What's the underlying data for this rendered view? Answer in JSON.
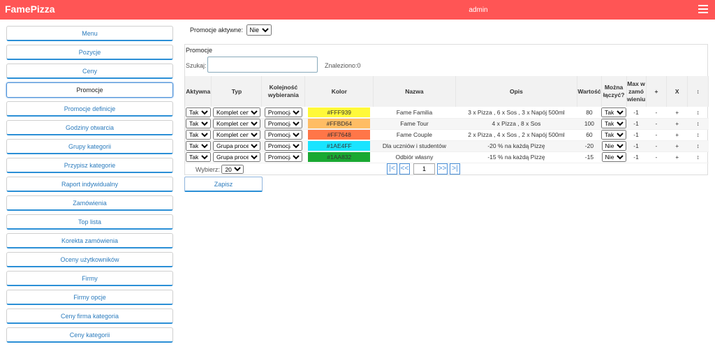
{
  "app": {
    "title": "FamePizza",
    "user": "admin"
  },
  "sidebar": {
    "items": [
      {
        "label": "Menu"
      },
      {
        "label": "Pozycje"
      },
      {
        "label": "Ceny"
      },
      {
        "label": "Promocje"
      },
      {
        "label": "Promocje definicje"
      },
      {
        "label": "Godziny otwarcia"
      },
      {
        "label": "Grupy kategorii"
      },
      {
        "label": "Przypisz kategorie"
      },
      {
        "label": "Raport indywidualny"
      },
      {
        "label": "Zamówienia"
      },
      {
        "label": "Top lista"
      },
      {
        "label": "Korekta zamówienia"
      },
      {
        "label": "Oceny użytkowników"
      },
      {
        "label": "Firmy"
      },
      {
        "label": "Firmy opcje"
      },
      {
        "label": "Ceny firma kategoria"
      },
      {
        "label": "Ceny kategorii"
      }
    ],
    "active_index": 3
  },
  "filter": {
    "label": "Promocje aktywne:",
    "value": "Nie"
  },
  "panel": {
    "title": "Promocje",
    "search_label": "Szukaj:",
    "search_value": "",
    "found": "Znaleziono:0"
  },
  "table": {
    "headers": [
      "Aktywna",
      "Typ",
      "Kolejność wybierania",
      "Kolor",
      "Nazwa",
      "Opis",
      "Wartość",
      "Można łączyć?",
      "Max w zamó wieniu",
      "+",
      "X",
      "↕"
    ],
    "rows": [
      {
        "aktywna": "Tak",
        "typ": "Komplet cena",
        "kolejnosc": "Promocja",
        "kolor": "#FFF939",
        "color_hex": "#FFF939",
        "nazwa": "Fame Familia",
        "opis": "3 x Pizza , 6 x Sos , 3 x Napój 500ml",
        "wartosc": "80",
        "laczyc": "Tak",
        "max": "-1",
        "plus": "-",
        "x": "+",
        "move": "↕"
      },
      {
        "aktywna": "Tak",
        "typ": "Komplet cena",
        "kolejnosc": "Promocja",
        "kolor": "#FFBD64",
        "color_hex": "#FFBD64",
        "nazwa": "Fame Tour",
        "opis": "4 x Pizza , 8 x Sos",
        "wartosc": "100",
        "laczyc": "Tak",
        "max": "-1",
        "plus": "-",
        "x": "+",
        "move": "↕"
      },
      {
        "aktywna": "Tak",
        "typ": "Komplet cena",
        "kolejnosc": "Promocja",
        "kolor": "#FF7648",
        "color_hex": "#FF7648",
        "nazwa": "Fame Couple",
        "opis": "2 x Pizza , 4 x Sos , 2 x Napój 500ml",
        "wartosc": "60",
        "laczyc": "Tak",
        "max": "-1",
        "plus": "-",
        "x": "+",
        "move": "↕"
      },
      {
        "aktywna": "Tak",
        "typ": "Grupa procent",
        "kolejnosc": "Promocja",
        "kolor": "#1AE4FF",
        "color_hex": "#1AE4FF",
        "nazwa": "Dla uczniów i studentów",
        "opis": "-20 % na każdą Pizzę",
        "wartosc": "-20",
        "laczyc": "Nie",
        "max": "-1",
        "plus": "-",
        "x": "+",
        "move": "↕"
      },
      {
        "aktywna": "Tak",
        "typ": "Grupa procent",
        "kolejnosc": "Promocja",
        "kolor": "#1AA832",
        "color_hex": "#1AA832",
        "nazwa": "Odbiór własny",
        "opis": "-15 % na każdą Pizzę",
        "wartosc": "-15",
        "laczyc": "Nie",
        "max": "-1",
        "plus": "-",
        "x": "+",
        "move": "↕"
      }
    ]
  },
  "pager": {
    "label": "Wybierz:",
    "per_page": "20",
    "page": "1",
    "first": "|<",
    "prev": "<<",
    "next": ">>",
    "last": ">|"
  },
  "save_label": "Zapisz",
  "colors": {
    "topbar": "#ff5555",
    "accent": "#2b8fd6"
  }
}
